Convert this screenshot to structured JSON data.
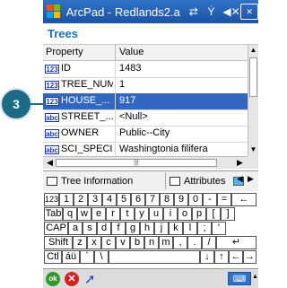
{
  "callout": {
    "number": "3"
  },
  "titlebar": {
    "title": "ArcPad - Redlands2.a"
  },
  "header": {
    "title": "Trees"
  },
  "grid": {
    "columns": [
      "Property",
      "Value"
    ],
    "rows": [
      {
        "type": "123",
        "field": "ID",
        "value": "1483"
      },
      {
        "type": "123",
        "field": "TREE_NUM",
        "value": "1"
      },
      {
        "type": "123",
        "field": "HOUSE_...",
        "value": "917"
      },
      {
        "type": "abc",
        "field": "STREET_...",
        "value": "<Null>"
      },
      {
        "type": "abc",
        "field": "OWNER",
        "value": "Public--City"
      },
      {
        "type": "abc",
        "field": "SCI_SPECIE",
        "value": "Washingtonia filifera"
      }
    ]
  },
  "tabs": {
    "tree_information": "Tree Information",
    "attributes": "Attributes"
  },
  "keyboard": {
    "row1": [
      "123",
      "1",
      "2",
      "3",
      "4",
      "5",
      "6",
      "7",
      "8",
      "9",
      "0",
      "-",
      "=",
      "←"
    ],
    "row2": [
      "Tab",
      "q",
      "w",
      "e",
      "r",
      "t",
      "y",
      "u",
      "i",
      "o",
      "p",
      "[",
      "]"
    ],
    "row3": [
      "CAP",
      "a",
      "s",
      "d",
      "f",
      "g",
      "h",
      "j",
      "k",
      "l",
      ";",
      "'"
    ],
    "row4": [
      "Shift",
      "z",
      "x",
      "c",
      "v",
      "b",
      "n",
      "m",
      ",",
      ".",
      "/",
      "↵"
    ],
    "row5": [
      "Ctl",
      "áü",
      "`",
      "\\",
      "",
      "↓",
      "↑",
      "←",
      "→"
    ]
  },
  "bottom": {
    "ok_label": "ok"
  }
}
